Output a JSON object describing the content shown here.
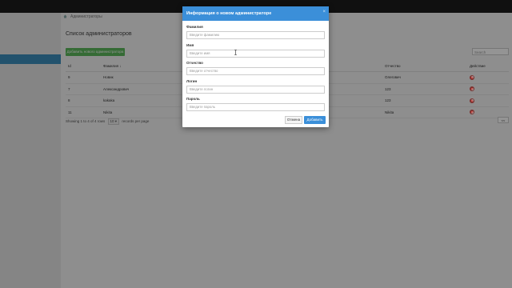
{
  "breadcrumb": {
    "label": "Администраторы"
  },
  "page": {
    "title": "Список администраторов",
    "add_button": "Добавить нового администратора",
    "search_placeholder": "Search"
  },
  "table": {
    "headers": [
      "Id",
      "Фамилия ↓",
      "",
      "",
      "Отчество",
      "Действие"
    ],
    "rows": [
      [
        "9",
        "Новик",
        "",
        "",
        "Олегович"
      ],
      [
        "7",
        "Александрович",
        "",
        "",
        "123"
      ],
      [
        "8",
        "kakaka",
        "",
        "",
        "123"
      ],
      [
        "11",
        "Nikita",
        "",
        "",
        "Nikita"
      ]
    ]
  },
  "footer": {
    "showing": "Showing 1 to 4 of 4 rows",
    "per_page_value": "10 ▾",
    "per_page_suffix": "records per page",
    "pager": "<<"
  },
  "modal": {
    "title": "Информация о новом администраторе",
    "close": "×",
    "fields": [
      {
        "label": "Фамилия",
        "placeholder": "Введите фамилию"
      },
      {
        "label": "Имя",
        "placeholder": "Введите имя"
      },
      {
        "label": "Отчество",
        "placeholder": "Введите отчество"
      },
      {
        "label": "Логин",
        "placeholder": "Введите логин"
      },
      {
        "label": "Пароль",
        "placeholder": "Введите пароль"
      }
    ],
    "cancel_button": "Отмена",
    "submit_button": "Добавить"
  },
  "colors": {
    "accent": "#3b8fd9",
    "success": "#5cb85c",
    "danger": "#d9534f"
  }
}
